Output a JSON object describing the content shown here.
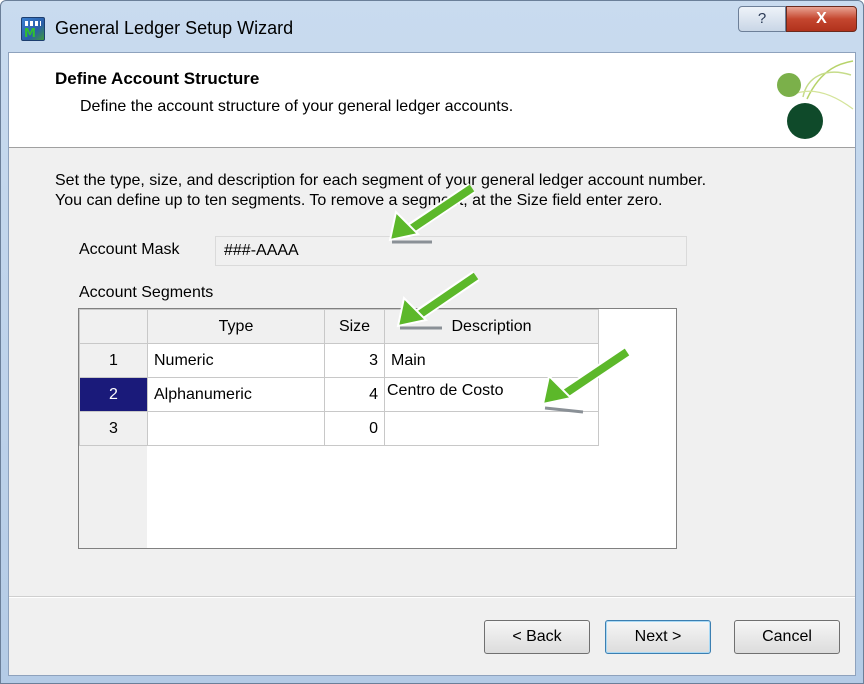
{
  "window": {
    "title": "General Ledger Setup Wizard",
    "help_glyph": "?",
    "close_glyph": "X"
  },
  "header": {
    "title": "Define Account Structure",
    "subtitle": "Define the account structure of your general ledger accounts."
  },
  "instructions": {
    "line1": "Set the type, size, and description for each segment of your general ledger account number.",
    "line2": "You can define up to ten segments.  To remove a segment, at the Size field enter zero."
  },
  "account_mask": {
    "label": "Account Mask",
    "value": "###-AAAA"
  },
  "segments": {
    "label": "Account Segments",
    "columns": {
      "type": "Type",
      "size": "Size",
      "description": "Description"
    },
    "rows": [
      {
        "num": "1",
        "type": "Numeric",
        "size": "3",
        "description": "Main",
        "selected": false
      },
      {
        "num": "2",
        "type": "Alphanumeric",
        "size": "4",
        "description": "Centro de Costo",
        "selected": true
      },
      {
        "num": "3",
        "type": "",
        "size": "0",
        "description": "",
        "selected": false
      }
    ]
  },
  "buttons": {
    "back": "< Back",
    "next": "Next >",
    "cancel": "Cancel"
  },
  "colors": {
    "selected_row_header": "#1a1a7a",
    "annotation_arrow": "#5cb82a"
  },
  "annotations": {
    "arrow_count": 3,
    "icon": "green-arrow-icon"
  }
}
